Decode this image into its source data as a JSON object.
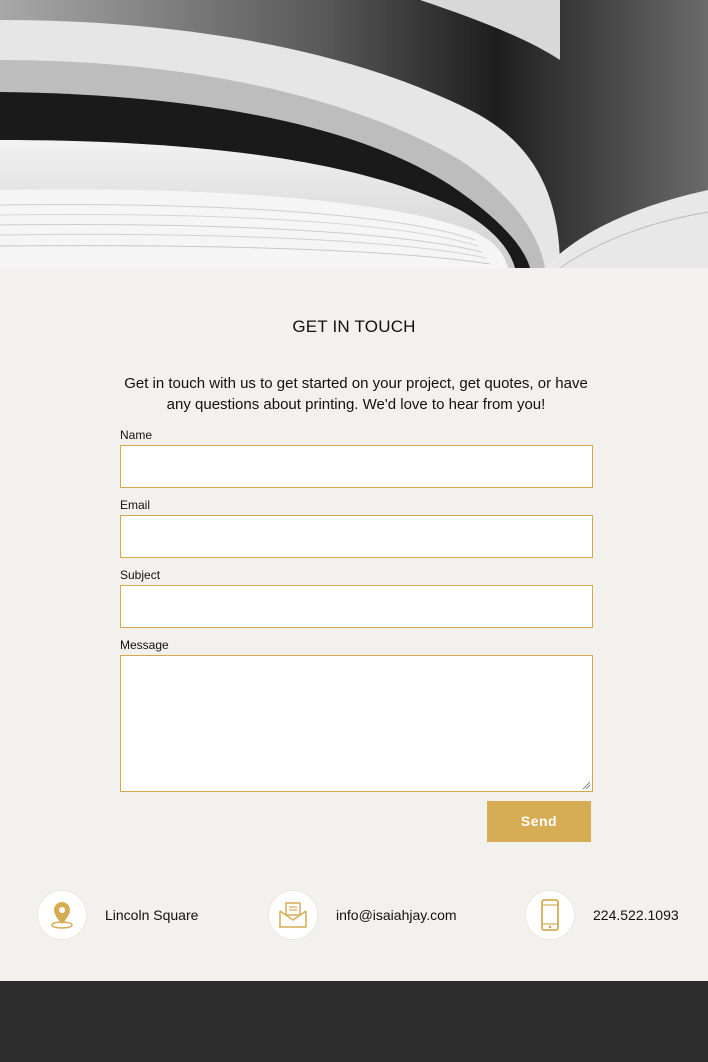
{
  "contact_section": {
    "title": "GET IN TOUCH",
    "intro": "Get in touch with us to get started on your project, get quotes, or have any questions about printing. We'd love to hear from you!"
  },
  "form": {
    "name_label": "Name",
    "email_label": "Email",
    "subject_label": "Subject",
    "message_label": "Message",
    "name_value": "",
    "email_value": "",
    "subject_value": "",
    "message_value": "",
    "send_label": "Send"
  },
  "contact_info": {
    "location": {
      "icon": "location-pin-icon",
      "text": "Lincoln Square"
    },
    "email": {
      "icon": "envelope-icon",
      "text": "info@isaiahjay.com"
    },
    "phone": {
      "icon": "phone-icon",
      "text": "224.522.1093"
    }
  },
  "colors": {
    "accent": "#d6ac55",
    "background": "#f3f1ed",
    "footer": "#2d2d2d"
  }
}
